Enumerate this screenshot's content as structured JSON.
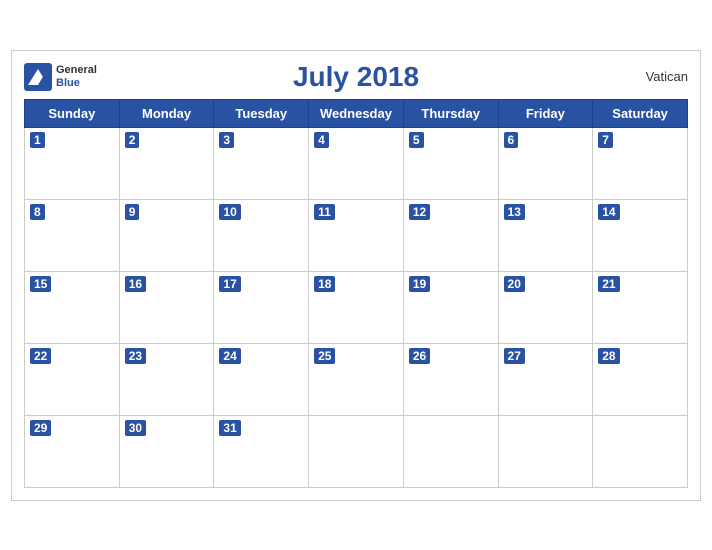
{
  "header": {
    "title": "July 2018",
    "country": "Vatican",
    "logo_general": "General",
    "logo_blue": "Blue"
  },
  "days_of_week": [
    "Sunday",
    "Monday",
    "Tuesday",
    "Wednesday",
    "Thursday",
    "Friday",
    "Saturday"
  ],
  "weeks": [
    [
      {
        "date": "1",
        "empty": false
      },
      {
        "date": "2",
        "empty": false
      },
      {
        "date": "3",
        "empty": false
      },
      {
        "date": "4",
        "empty": false
      },
      {
        "date": "5",
        "empty": false
      },
      {
        "date": "6",
        "empty": false
      },
      {
        "date": "7",
        "empty": false
      }
    ],
    [
      {
        "date": "8",
        "empty": false
      },
      {
        "date": "9",
        "empty": false
      },
      {
        "date": "10",
        "empty": false
      },
      {
        "date": "11",
        "empty": false
      },
      {
        "date": "12",
        "empty": false
      },
      {
        "date": "13",
        "empty": false
      },
      {
        "date": "14",
        "empty": false
      }
    ],
    [
      {
        "date": "15",
        "empty": false
      },
      {
        "date": "16",
        "empty": false
      },
      {
        "date": "17",
        "empty": false
      },
      {
        "date": "18",
        "empty": false
      },
      {
        "date": "19",
        "empty": false
      },
      {
        "date": "20",
        "empty": false
      },
      {
        "date": "21",
        "empty": false
      }
    ],
    [
      {
        "date": "22",
        "empty": false
      },
      {
        "date": "23",
        "empty": false
      },
      {
        "date": "24",
        "empty": false
      },
      {
        "date": "25",
        "empty": false
      },
      {
        "date": "26",
        "empty": false
      },
      {
        "date": "27",
        "empty": false
      },
      {
        "date": "28",
        "empty": false
      }
    ],
    [
      {
        "date": "29",
        "empty": false
      },
      {
        "date": "30",
        "empty": false
      },
      {
        "date": "31",
        "empty": false
      },
      {
        "date": "",
        "empty": true
      },
      {
        "date": "",
        "empty": true
      },
      {
        "date": "",
        "empty": true
      },
      {
        "date": "",
        "empty": true
      }
    ]
  ]
}
